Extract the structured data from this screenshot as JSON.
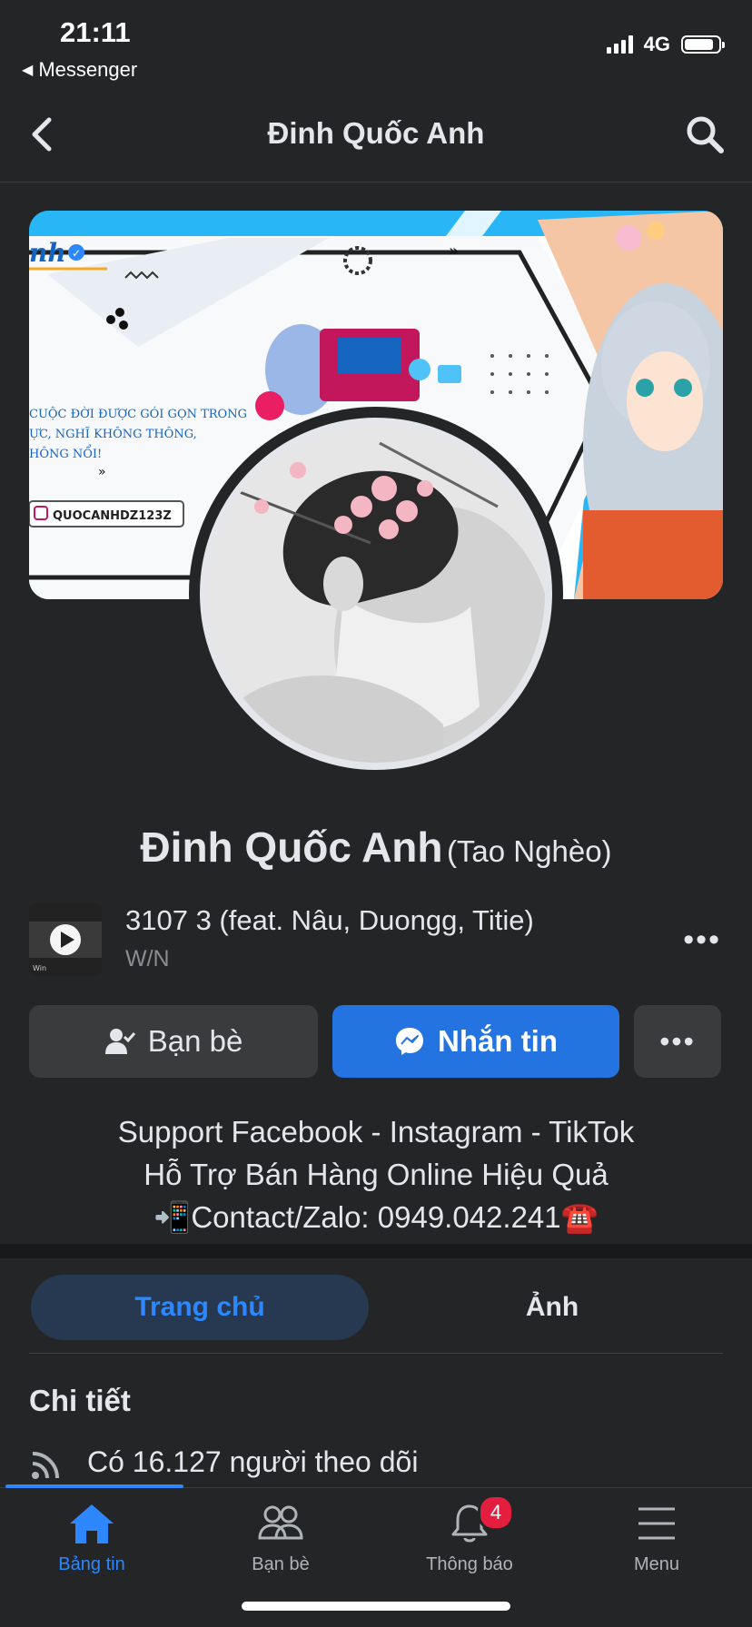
{
  "status_bar": {
    "time": "21:11",
    "back_app": "Messenger",
    "network": "4G",
    "battery_level": 0.85
  },
  "header": {
    "title": "Đinh Quốc Anh",
    "back_icon": "chevron-left-icon",
    "search_icon": "search-icon"
  },
  "cover": {
    "brand_fragment": "nh",
    "tagline_lines": [
      "CUỘC ĐỜI ĐƯỢC GÓI GỌN TRONG",
      "ỰC, NGHĨ KHÔNG THÔNG,",
      "HÔNG NỔI!"
    ],
    "handle": "QUOCANHDZ123Z"
  },
  "profile": {
    "name": "Đinh Quốc Anh",
    "alternate_name": "(Tao Nghèo)"
  },
  "music": {
    "title": "3107 3 (feat. Nâu, Duongg, Titie)",
    "artist": "W/N",
    "thumb_label": "Win",
    "more_label": "•••"
  },
  "actions": {
    "friends_label": "Bạn bè",
    "message_label": "Nhắn tin",
    "more_label": "•••"
  },
  "bio": {
    "line1": "Support Facebook - Instagram - TikTok",
    "line2": "Hỗ Trợ Bán Hàng Online Hiệu Quả",
    "line3": "📲Contact/Zalo: 0949.042.241☎️"
  },
  "tabs": {
    "home": "Trang chủ",
    "photos": "Ảnh"
  },
  "details": {
    "title": "Chi tiết",
    "followers": "Có 16.127 người theo dõi"
  },
  "bottom_nav": {
    "items": [
      {
        "label": "Bảng tin",
        "icon": "home-icon",
        "active": true
      },
      {
        "label": "Bạn bè",
        "icon": "friends-icon"
      },
      {
        "label": "Thông báo",
        "icon": "bell-icon",
        "badge": "4"
      },
      {
        "label": "Menu",
        "icon": "menu-icon"
      }
    ]
  },
  "colors": {
    "background": "#242526",
    "accent": "#2d88ff",
    "primary_button": "#2374e1",
    "badge": "#e41e3f"
  }
}
